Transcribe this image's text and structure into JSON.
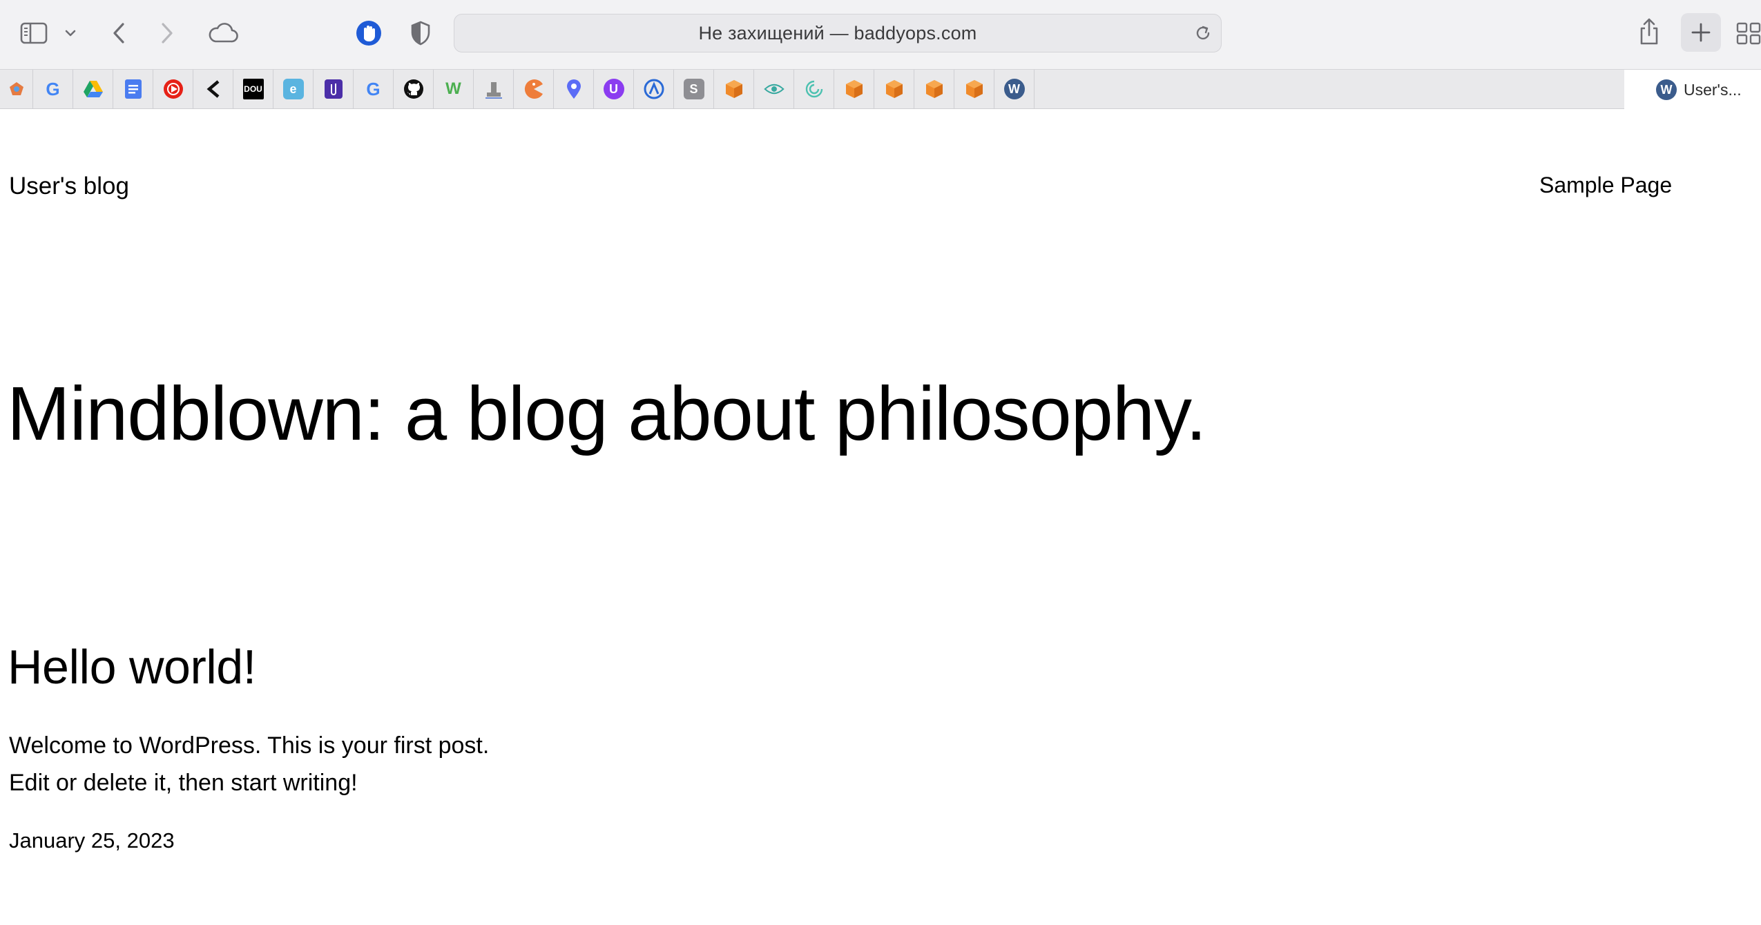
{
  "browser": {
    "address": "Не захищений — baddyops.com",
    "active_tab": {
      "label": "User's...",
      "icon": "wordpress-icon"
    },
    "toolbar_icons": [
      "sidebar-icon",
      "chevron-down-icon",
      "back-icon",
      "forward-icon",
      "cloud-icon",
      "hand-stop-icon",
      "shield-icon",
      "reload-icon",
      "share-icon",
      "plus-icon",
      "tab-overview-icon"
    ],
    "pinned_tabs": [
      {
        "icon": "pinned-favicon-icon",
        "glyph": "",
        "color": "#e57b42"
      },
      {
        "icon": "google-icon",
        "glyph": "G",
        "color": "#4285f4"
      },
      {
        "icon": "google-drive-icon",
        "glyph": "",
        "color": "#1fa463"
      },
      {
        "icon": "google-docs-icon",
        "glyph": "",
        "color": "#4a7cf0"
      },
      {
        "icon": "youtube-music-icon",
        "glyph": "",
        "color": "#e62117"
      },
      {
        "icon": "chevron-logo-icon",
        "glyph": "‹",
        "color": "#111111"
      },
      {
        "icon": "dou-icon",
        "glyph": "DOU",
        "color": "#000000"
      },
      {
        "icon": "e-letter-icon",
        "glyph": "e",
        "color": "#5ab4e0"
      },
      {
        "icon": "paperclip-icon",
        "glyph": "",
        "color": "#4b2ea8"
      },
      {
        "icon": "google-translate-icon",
        "glyph": "G",
        "color": "#4285f4"
      },
      {
        "icon": "github-icon",
        "glyph": "",
        "color": "#111111"
      },
      {
        "icon": "w3-icon",
        "glyph": "W",
        "color": "#4caf50"
      },
      {
        "icon": "stamp-icon",
        "glyph": "",
        "color": "#8a8a8a"
      },
      {
        "icon": "pacman-icon",
        "glyph": "",
        "color": "#ee7d3b"
      },
      {
        "icon": "location-pin-icon",
        "glyph": "",
        "color": "#5b6cf6"
      },
      {
        "icon": "u-badge-icon",
        "glyph": "U",
        "color": "#8b3cf0"
      },
      {
        "icon": "arc-logo-icon",
        "glyph": "",
        "color": "#2a6ad6"
      },
      {
        "icon": "s-letter-icon",
        "glyph": "S",
        "color": "#8e8e93"
      },
      {
        "icon": "orange-cube-icon",
        "glyph": "",
        "color": "#f08a2a"
      },
      {
        "icon": "eye-icon",
        "glyph": "",
        "color": "#38a9a0"
      },
      {
        "icon": "swirl-icon",
        "glyph": "",
        "color": "#4cc1b0"
      },
      {
        "icon": "orange-cube-icon",
        "glyph": "",
        "color": "#f08a2a"
      },
      {
        "icon": "orange-cube-icon",
        "glyph": "",
        "color": "#f08a2a"
      },
      {
        "icon": "orange-cube-icon",
        "glyph": "",
        "color": "#f08a2a"
      },
      {
        "icon": "orange-cube-icon",
        "glyph": "",
        "color": "#f08a2a"
      },
      {
        "icon": "wordpress-icon",
        "glyph": "W",
        "color": "#3b5c8c"
      }
    ]
  },
  "site": {
    "title": "User's blog",
    "nav": [
      "Sample Page"
    ],
    "hero": "Mindblown: a blog about philosophy.",
    "post": {
      "title": "Hello world!",
      "excerpt_line1": "Welcome to WordPress. This is your first post.",
      "excerpt_line2": "Edit or delete it, then start writing!",
      "date": "January 25, 2023"
    }
  }
}
